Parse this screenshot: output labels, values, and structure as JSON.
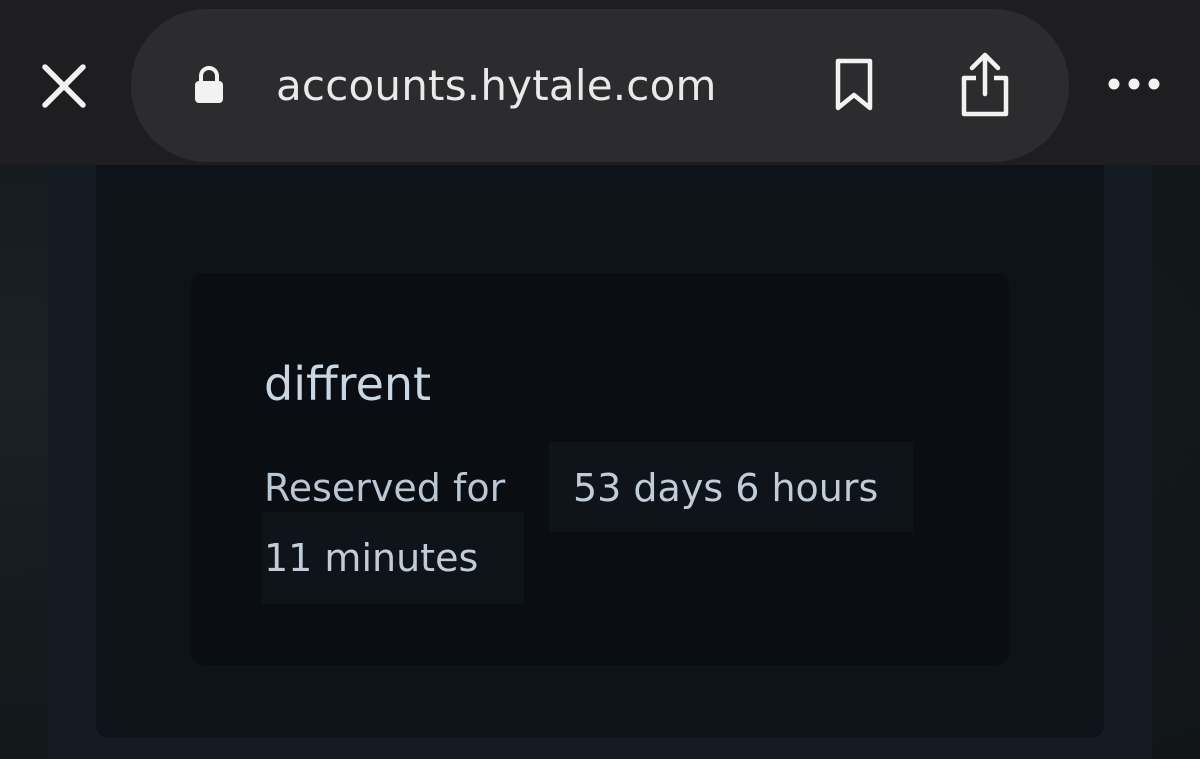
{
  "browser": {
    "url": "accounts.hytale.com",
    "icons": {
      "close": "close-icon",
      "lock": "lock-icon",
      "bookmark": "bookmark-icon",
      "share": "share-icon",
      "more": "more-icon"
    }
  },
  "reservation": {
    "name": "diffrent",
    "label": "Reserved for",
    "time_line_1": "53 days 6 hours",
    "time_line_2": "11 minutes"
  },
  "colors": {
    "toolbar_bg": "#1e1e20",
    "url_pill_bg": "#2c2c2e",
    "panel_bg": "#0e131a",
    "card_bg": "#0a0d11",
    "text_primary": "#c9d6e3"
  }
}
